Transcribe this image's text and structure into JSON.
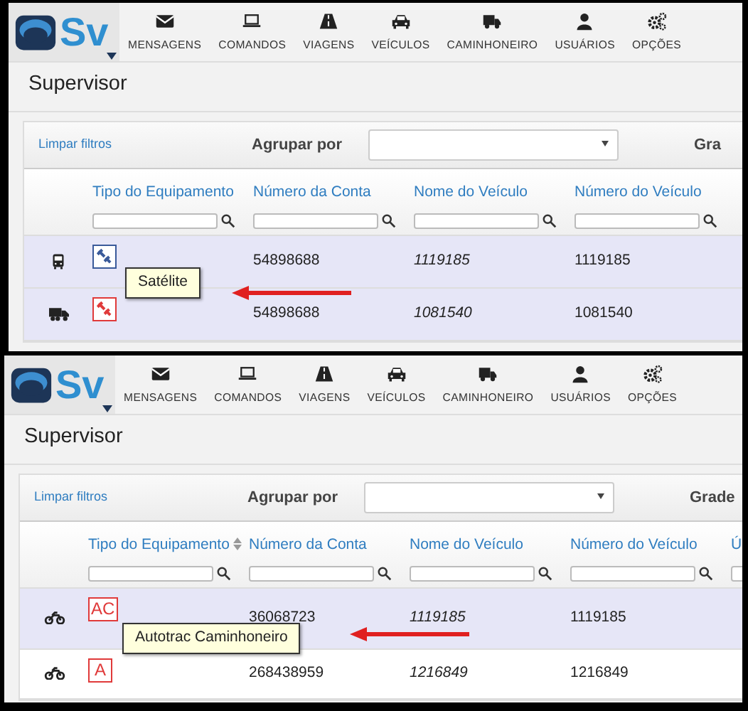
{
  "panels": [
    {
      "nav": {
        "logo": "Sv",
        "items": [
          "MENSAGENS",
          "COMANDOS",
          "VIAGENS",
          "VEÍCULOS",
          "CAMINHONEIRO",
          "USUÁRIOS",
          "OPÇÕES"
        ]
      },
      "page_title": "Supervisor",
      "toolbar": {
        "clear_link": "Limpar filtros",
        "group_label": "Agrupar por",
        "right_label": "Gra"
      },
      "columns": [
        {
          "label": "Tipo do Equipamento",
          "sort": false
        },
        {
          "label": "Número da Conta",
          "sort": false
        },
        {
          "label": "Nome do Veículo",
          "sort": false
        },
        {
          "label": "Número do Veículo",
          "sort": false
        }
      ],
      "rows": [
        {
          "kind": "bus",
          "equipment": {
            "kind": "satellite",
            "color": "#3a5a9a"
          },
          "account": "54898688",
          "vehicle_name": "1119185",
          "vehicle_number": "1119185",
          "selected": true
        },
        {
          "kind": "truck",
          "equipment": {
            "kind": "satellite",
            "color": "#e03a3a"
          },
          "account": "54898688",
          "vehicle_name": "1081540",
          "vehicle_number": "1081540",
          "selected": true
        }
      ],
      "tooltip": "Satélite"
    },
    {
      "nav": {
        "logo": "Sv",
        "items": [
          "MENSAGENS",
          "COMANDOS",
          "VIAGENS",
          "VEÍCULOS",
          "CAMINHONEIRO",
          "USUÁRIOS",
          "OPÇÕES"
        ]
      },
      "page_title": "Supervisor",
      "toolbar": {
        "clear_link": "Limpar filtros",
        "group_label": "Agrupar por",
        "right_label": "Grade"
      },
      "columns": [
        {
          "label": "Tipo do Equipamento",
          "sort": true
        },
        {
          "label": "Número da Conta",
          "sort": false
        },
        {
          "label": "Nome do Veículo",
          "sort": false
        },
        {
          "label": "Número do Veículo",
          "sort": false
        },
        {
          "label": "Ú",
          "sort": false
        }
      ],
      "rows": [
        {
          "kind": "motorcycle",
          "equipment": {
            "kind": "letters",
            "text": "AC",
            "color": "#e03a3a"
          },
          "account": "36068723",
          "vehicle_name": "1119185",
          "vehicle_number": "1119185",
          "selected": true
        },
        {
          "kind": "motorcycle",
          "equipment": {
            "kind": "letters",
            "text": "A",
            "color": "#e03a3a"
          },
          "account": "268438959",
          "vehicle_name": "1216849",
          "vehicle_number": "1216849",
          "selected": false
        }
      ],
      "tooltip": "Autotrac Caminhoneiro"
    }
  ]
}
